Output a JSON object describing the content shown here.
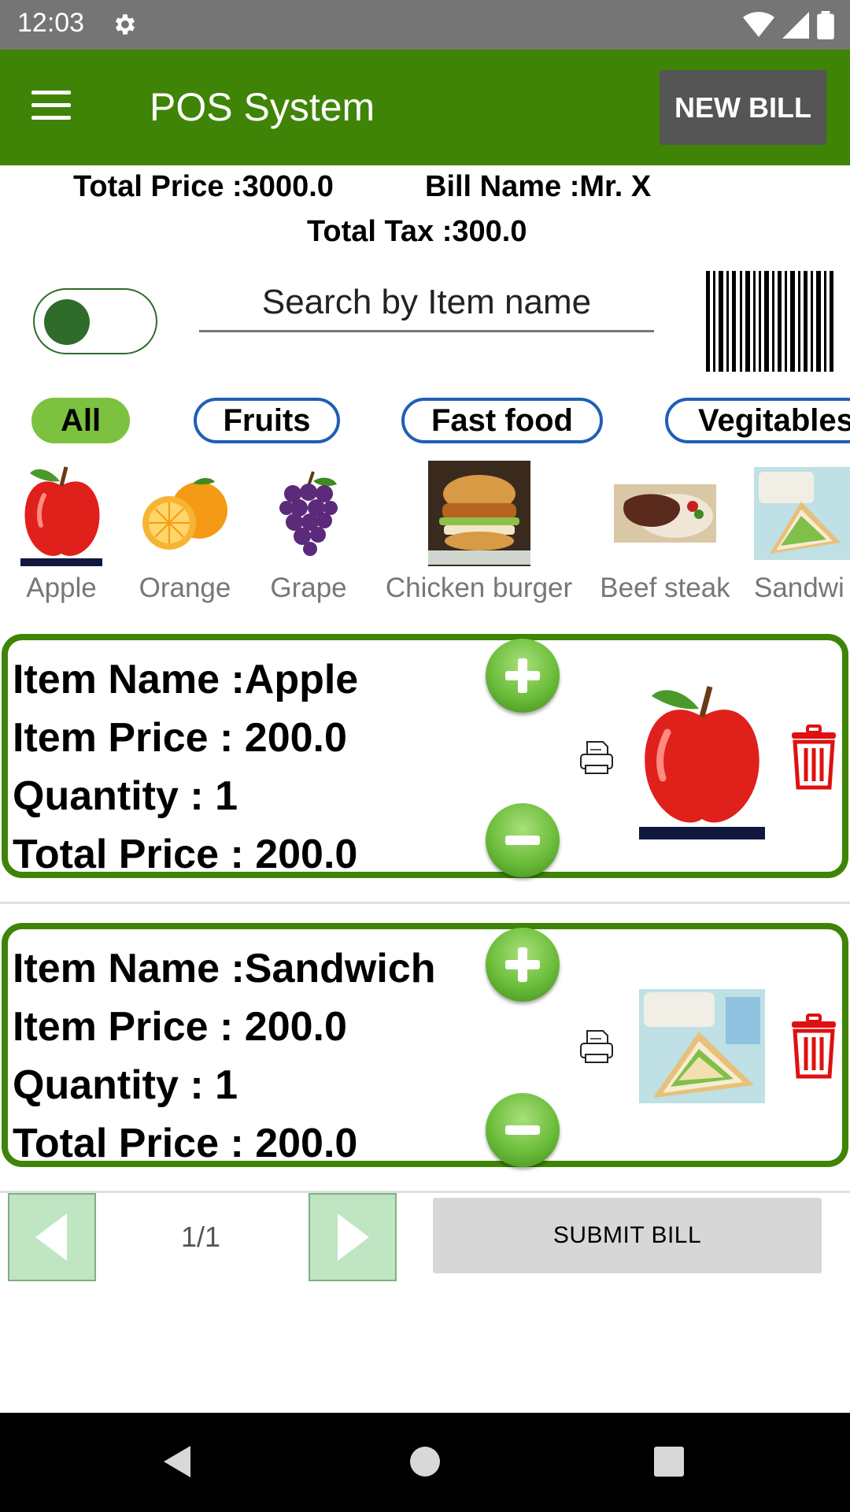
{
  "status_bar": {
    "time": "12:03"
  },
  "app_bar": {
    "title": "POS System",
    "new_bill_label": "NEW BILL"
  },
  "summary": {
    "total_price": "Total Price :3000.0",
    "bill_name": "Bill Name :Mr. X",
    "total_tax": "Total Tax :300.0"
  },
  "search": {
    "placeholder": "Search by Item name",
    "value": ""
  },
  "categories": [
    {
      "label": "All"
    },
    {
      "label": "Fruits"
    },
    {
      "label": "Fast food"
    },
    {
      "label": "Vegitables"
    }
  ],
  "products": [
    {
      "label": "Apple"
    },
    {
      "label": "Orange"
    },
    {
      "label": "Grape"
    },
    {
      "label": "Chicken burger"
    },
    {
      "label": "Beef steak"
    },
    {
      "label": "Sandwi"
    }
  ],
  "bill_items": [
    {
      "name": "Item Name :Apple",
      "price": "Item Price : 200.0",
      "quantity": "Quantity : 1",
      "total": "Total Price : 200.0"
    },
    {
      "name": "Item Name :Sandwich",
      "price": "Item Price : 200.0",
      "quantity": "Quantity : 1",
      "total": "Total Price : 200.0"
    }
  ],
  "pagination": {
    "indicator": "1/1"
  },
  "submit_label": "SUBMIT BILL",
  "colors": {
    "app_bar": "#3f8406",
    "chip_active": "#7cc13f",
    "chip_border": "#1f5fb5",
    "card_border": "#3f8406"
  }
}
